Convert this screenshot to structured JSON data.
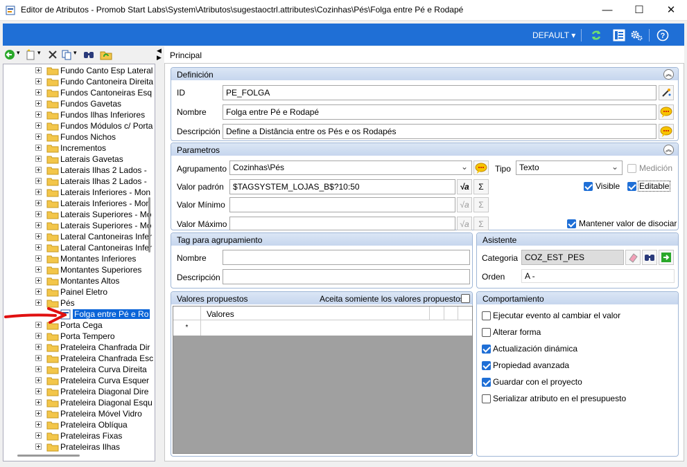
{
  "window": {
    "title": "Editor de Atributos - Promob Start Labs\\System\\Atributos\\sugestaoctrl.attributes\\Cozinhas\\Pés\\Folga entre Pé e Rodapé",
    "minimize": "—",
    "maximize": "☐",
    "close": "✕"
  },
  "toolbar": {
    "profile": "DEFAULT ▾"
  },
  "tree": {
    "items": [
      "Fundo Canto Esp Lateral",
      "Fundo Cantoneira Direita",
      "Fundos Cantoneiras Esq",
      "Fundos Gavetas",
      "Fundos Ilhas Inferiores",
      "Fundos Módulos c/ Porta",
      "Fundos Nichos",
      "Incrementos",
      "Laterais Gavetas",
      "Laterais Ilhas 2 Lados -",
      "Laterais Ilhas 2 Lados -",
      "Laterais Inferiores - Mon",
      "Laterais Inferiores - Mon",
      "Laterais Superiores - Mo",
      "Laterais Superiores - Mo",
      "Lateral Cantoneiras Infer",
      "Lateral Cantoneiras Infer",
      "Montantes Inferiores",
      "Montantes Superiores",
      "Montantes Altos",
      "Painel Eletro",
      "Pés",
      "Folga entre Pé e Ro",
      "Porta Cega",
      "Porta Tempero",
      "Prateleira Chanfrada Dir",
      "Prateleira Chanfrada Esc",
      "Prateleira Curva Direita",
      "Prateleira Curva Esquer",
      "Prateleira Diagonal Dire",
      "Prateleira Diagonal Esqu",
      "Prateleira Móvel Vidro",
      "Prateleira Oblíqua",
      "Prateleiras Fixas",
      "Prateleiras Ilhas"
    ]
  },
  "main": {
    "tab": "Principal",
    "definicion": {
      "title": "Definición",
      "id_label": "ID",
      "id_value": "PE_FOLGA",
      "nombre_label": "Nombre",
      "nombre_value": "Folga entre Pé e Rodapé",
      "desc_label": "Descripción",
      "desc_value": "Define a Distância entre os Pés e os Rodapés"
    },
    "parametros": {
      "title": "Parametros",
      "agrup_label": "Agrupamento",
      "agrup_value": "Cozinhas\\Pés",
      "tipo_label": "Tipo",
      "tipo_value": "Texto",
      "medicion": "Medición",
      "padron_label": "Valor padrón",
      "padron_value": "$TAGSYSTEM_LOJAS_B$?10:50",
      "visible": "Visible",
      "editable": "Editable",
      "minimo_label": "Valor Mínimo",
      "maximo_label": "Valor Máximo",
      "mantener": "Mantener valor de disociar",
      "sigma": "Σ"
    },
    "tag": {
      "title": "Tag para agrupamiento",
      "nombre_label": "Nombre",
      "desc_label": "Descripción"
    },
    "asistente": {
      "title": "Asistente",
      "categoria_label": "Categoria",
      "categoria_value": "COZ_EST_PES",
      "orden_label": "Orden",
      "orden_value": "A -"
    },
    "valores": {
      "title": "Valores propuestos",
      "acepta": "Aceita somiente los valores propuestos",
      "col": "Valores",
      "new_row": "*"
    },
    "comportamiento": {
      "title": "Comportamiento",
      "items": [
        {
          "label": "Ejecutar evento al cambiar el valor",
          "checked": false
        },
        {
          "label": "Alterar forma",
          "checked": false
        },
        {
          "label": "Actualización dinámica",
          "checked": true
        },
        {
          "label": "Propiedad avanzada",
          "checked": true
        },
        {
          "label": "Guardar con el proyecto",
          "checked": true
        },
        {
          "label": "Serializar atributo en el presupuesto",
          "checked": false
        }
      ]
    }
  },
  "colors": {
    "accent": "#1f6fd6",
    "selection": "#0a64d8",
    "arrow": "#e01010"
  }
}
